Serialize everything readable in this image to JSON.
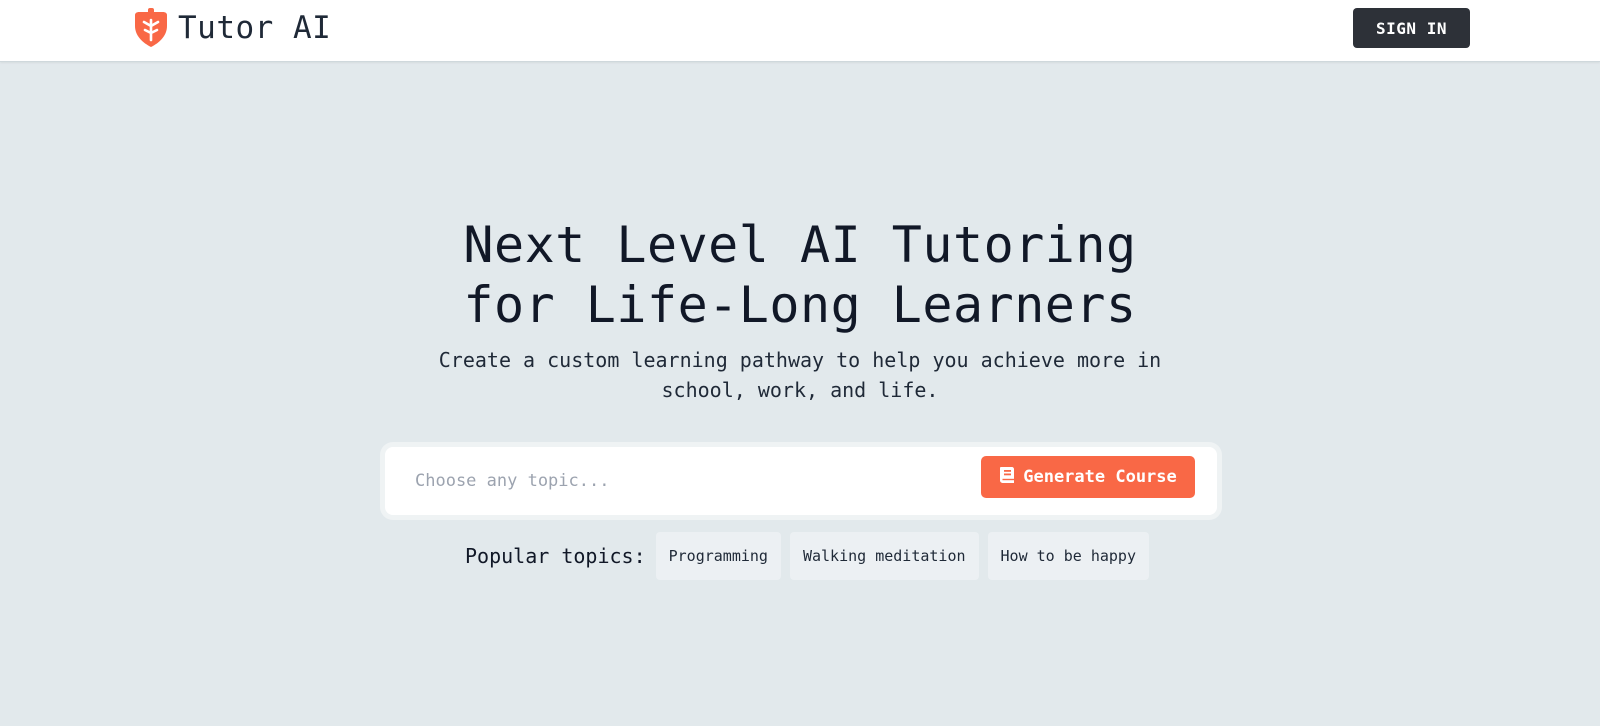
{
  "header": {
    "brand_name": "Tutor AI",
    "logo_icon": "acorn-shield-icon",
    "signin_label": "SIGN IN"
  },
  "hero": {
    "title_line1": "Next Level AI Tutoring",
    "title_line2": "for Life-Long Learners",
    "subtitle_line1": "Create a custom learning pathway to help you achieve more in",
    "subtitle_line2": "school, work, and life."
  },
  "search": {
    "placeholder": "Choose any topic...",
    "value": "",
    "button_icon": "book-icon",
    "button_label": "Generate Course"
  },
  "popular": {
    "label": "Popular topics:",
    "topics": [
      "Programming",
      "Walking meditation",
      "How to be happy"
    ]
  },
  "colors": {
    "accent": "#f96846",
    "dark_button": "#2d3138",
    "background": "#e2e9ec",
    "chip": "#ecf0f3"
  }
}
